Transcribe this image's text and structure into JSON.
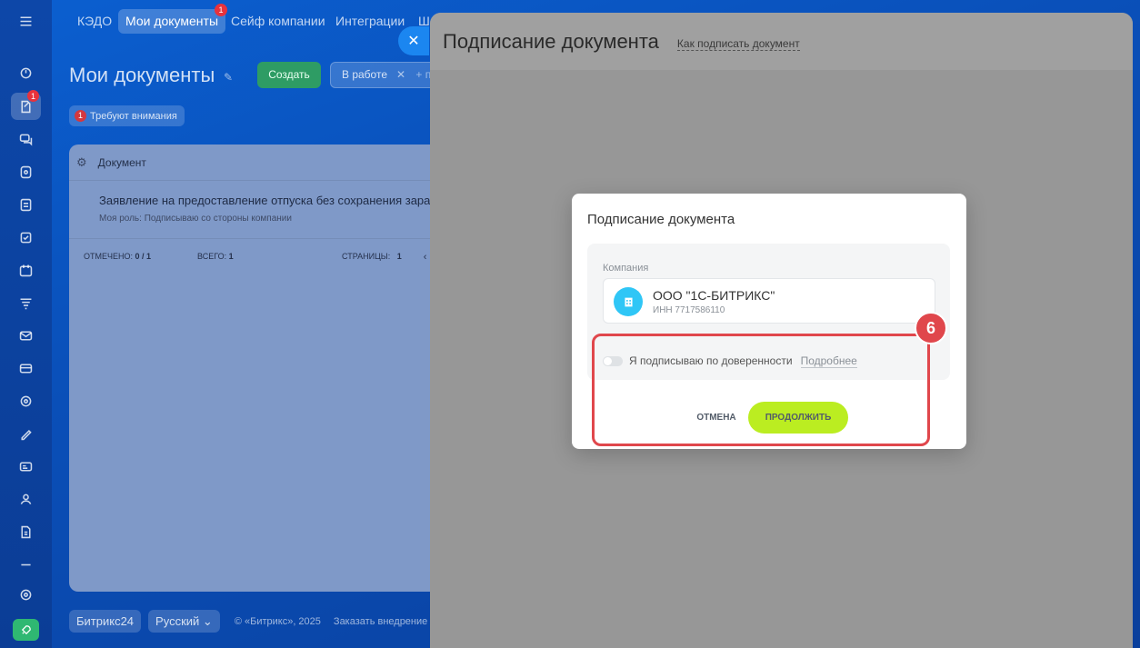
{
  "nav": {
    "items": [
      {
        "label": "КЭДО"
      },
      {
        "label": "Мои документы",
        "badge": "1"
      },
      {
        "label": "Сейф компании"
      },
      {
        "label": "Интеграции"
      },
      {
        "label": "Ш"
      }
    ]
  },
  "rail": {
    "doc_badge": "1"
  },
  "page": {
    "title": "Мои документы",
    "create_label": "Создать",
    "filter_label": "В работе",
    "filter_more": "+ п",
    "attention_count": "1",
    "attention_label": "Требуют внимания"
  },
  "grid": {
    "column_header": "Документ",
    "rows": [
      {
        "title": "Заявление на предоставление отпуска без сохранения зараб.",
        "role": "Моя роль: Подписываю со стороны компании"
      }
    ],
    "footer": {
      "checked_label": "ОТМЕЧЕНО:",
      "checked_value": "0 / 1",
      "total_label": "ВСЕГО:",
      "total_value": "1",
      "pages_label": "СТРАНИЦЫ:",
      "pages_value": "1"
    }
  },
  "bottom": {
    "brand": "Битрикс24",
    "language": "Русский",
    "copyright": "© «Битрикс», 2025",
    "order_link": "Заказать внедрение"
  },
  "slider": {
    "title": "Подписание документа",
    "help_link": "Как подписать документ"
  },
  "modal": {
    "title": "Подписание документа",
    "company_label": "Компания",
    "company_name": "ООО \"1С-БИТРИКС\"",
    "company_inn": "ИНН 7717586110",
    "proxy_label": "Я подписываю по доверенности",
    "more_link": "Подробнее",
    "cancel_label": "ОТМЕНА",
    "continue_label": "ПРОДОЛЖИТЬ"
  },
  "annotation": {
    "step": "6",
    "color": "#e0474c"
  },
  "colors": {
    "accent_green": "#bbed21",
    "company_icon": "#2fc6f6",
    "create_button": "#2e9c64"
  }
}
